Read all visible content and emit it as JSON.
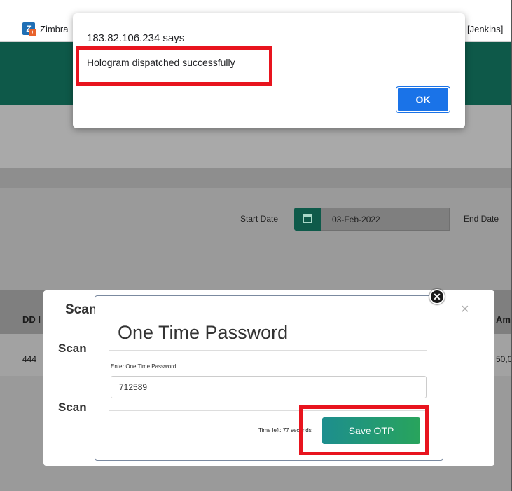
{
  "browser": {
    "tabs": [
      {
        "label": "Zimbra",
        "icon": "zimbra-logo-icon"
      },
      {
        "label": "[Jenkins]"
      }
    ]
  },
  "page": {
    "start_date_label": "Start Date",
    "start_date_value": "03-Feb-2022",
    "start_date_icon": "calendar-icon",
    "end_date_label": "End Date",
    "table": {
      "headers": [
        "DD I",
        "Am"
      ],
      "rows": [
        [
          "444",
          "50,0"
        ]
      ]
    }
  },
  "scan_modal": {
    "title": "Scan",
    "close_symbol": "×",
    "items": [
      "Scan",
      "Scan"
    ]
  },
  "otp_modal": {
    "title": "One Time Password",
    "field_label": "Enter One Time Password",
    "field_value": "712589",
    "timer_text": "Time left: 77 seconds",
    "save_label": "Save OTP",
    "close_symbol": "✕"
  },
  "alert": {
    "origin": "183.82.106.234 says",
    "message": "Hologram dispatched successfully",
    "ok_label": "OK"
  },
  "colors": {
    "accent_teal": "#0e5949",
    "highlight_red": "#e8141e",
    "dialog_blue": "#1a73e8",
    "save_gradient_start": "#1d8e8e",
    "save_gradient_end": "#28a45c"
  }
}
